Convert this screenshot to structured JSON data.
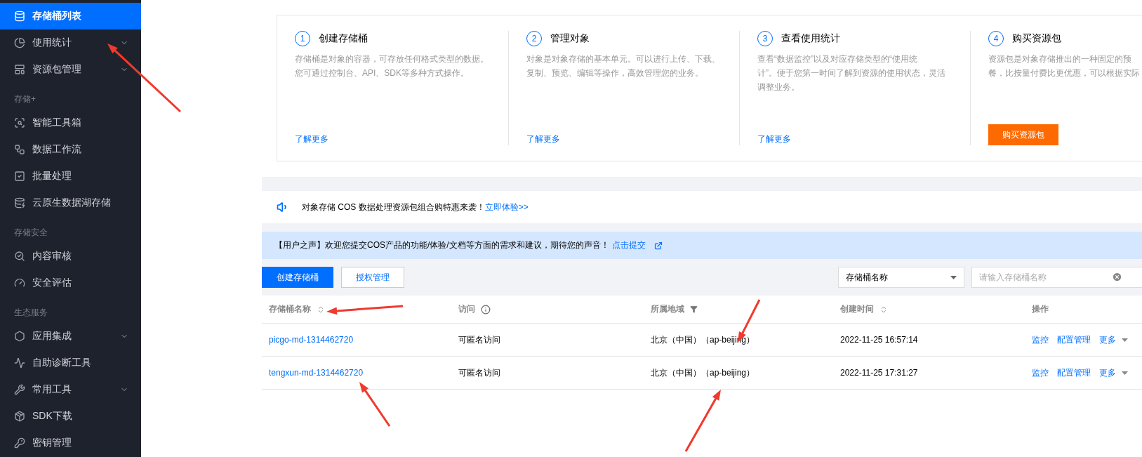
{
  "sidebar": {
    "sections": [
      {
        "items": [
          {
            "label": "存储桶列表",
            "selected": true,
            "expandable": false
          },
          {
            "label": "使用统计",
            "selected": false,
            "expandable": true
          },
          {
            "label": "资源包管理",
            "selected": false,
            "expandable": true
          }
        ]
      },
      {
        "title": "存储+",
        "items": [
          {
            "label": "智能工具箱",
            "selected": false,
            "expandable": false
          },
          {
            "label": "数据工作流",
            "selected": false,
            "expandable": false
          },
          {
            "label": "批量处理",
            "selected": false,
            "expandable": false
          },
          {
            "label": "云原生数据湖存储",
            "selected": false,
            "expandable": false
          }
        ]
      },
      {
        "title": "存储安全",
        "items": [
          {
            "label": "内容审核",
            "selected": false,
            "expandable": false
          },
          {
            "label": "安全评估",
            "selected": false,
            "expandable": false
          }
        ]
      },
      {
        "title": "生态服务",
        "items": [
          {
            "label": "应用集成",
            "selected": false,
            "expandable": true
          },
          {
            "label": "自助诊断工具",
            "selected": false,
            "expandable": false
          },
          {
            "label": "常用工具",
            "selected": false,
            "expandable": true
          },
          {
            "label": "SDK下载",
            "selected": false,
            "expandable": false
          },
          {
            "label": "密钥管理",
            "selected": false,
            "expandable": false
          }
        ]
      }
    ]
  },
  "steps": [
    {
      "number": "1",
      "title": "创建存储桶",
      "description": [
        "存储桶是对象的容器，可存放任何格式类型的数据。",
        "您可通过控制台、API、SDK等多种方式操作。"
      ],
      "action": {
        "kind": "link",
        "label": "了解更多"
      }
    },
    {
      "number": "2",
      "title": "管理对象",
      "description": [
        "对象是对象存储的基本单元。可以进行上传、下载、",
        "复制、预览、编辑等操作，高效管理您的业务。"
      ],
      "action": {
        "kind": "link",
        "label": "了解更多"
      }
    },
    {
      "number": "3",
      "title": "查看使用统计",
      "description": [
        "查看“数据监控”以及对应存储类型的“使用统",
        "计”。便于您第一时间了解到资源的使用状态，灵活",
        "调整业务。"
      ],
      "action": {
        "kind": "link",
        "label": "了解更多"
      }
    },
    {
      "number": "4",
      "title": "购买资源包",
      "description": [
        "资源包是对象存储推出的一种固定的预",
        "餐，比按量付费比更优惠，可以根据实际"
      ],
      "action": {
        "kind": "button",
        "label": "购买资源包"
      }
    }
  ],
  "announcement": {
    "text": "对象存储 COS 数据处理资源包组合购特惠来袭！",
    "link": "立即体验>>"
  },
  "notice": {
    "text": "【用户之声】欢迎您提交COS产品的功能/体验/文档等方面的需求和建议，期待您的声音！",
    "link": "点击提交"
  },
  "toolbar": {
    "buttons": [
      {
        "label": "创建存储桶",
        "kind": "primary"
      },
      {
        "label": "授权管理",
        "kind": "default"
      }
    ],
    "filter_select": "存储桶名称",
    "search": {
      "placeholder": "请输入存储桶名称"
    }
  },
  "table": {
    "columns": [
      {
        "label": "存储桶名称",
        "kind": "sort"
      },
      {
        "label": "访问",
        "kind": "info"
      },
      {
        "label": "所属地域",
        "kind": "filter"
      },
      {
        "label": "创建时间",
        "kind": "sort"
      },
      {
        "label": "操作",
        "kind": "plain"
      }
    ],
    "rows": [
      {
        "name": "picgo-md-1314462720",
        "access": "可匿名访问",
        "region": "北京（中国）（ap-beijing）",
        "created": "2022-11-25 16:57:14",
        "actions": [
          "监控",
          "配置管理"
        ],
        "more": "更多"
      },
      {
        "name": "tengxun-md-1314462720",
        "access": "可匿名访问",
        "region": "北京（中国）（ap-beijing）",
        "created": "2022-11-25 17:31:27",
        "actions": [
          "监控",
          "配置管理"
        ],
        "more": "更多"
      }
    ]
  }
}
